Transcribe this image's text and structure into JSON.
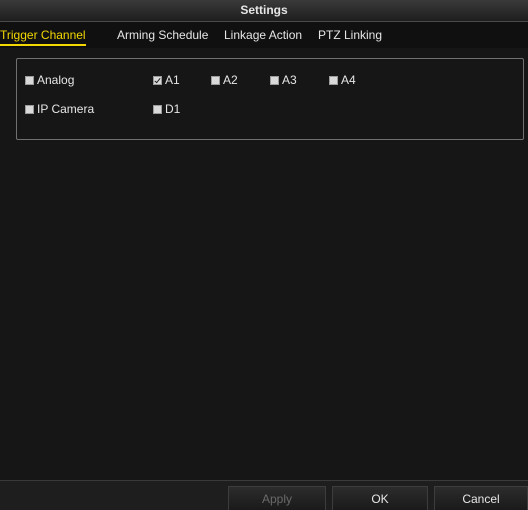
{
  "window": {
    "title": "Settings"
  },
  "tabs": [
    {
      "label": "Trigger Channel",
      "active": true
    },
    {
      "label": "Arming Schedule",
      "active": false
    },
    {
      "label": "Linkage Action",
      "active": false
    },
    {
      "label": "PTZ Linking",
      "active": false
    }
  ],
  "channels": {
    "analog": {
      "label": "Analog",
      "checked": false
    },
    "a1": {
      "label": "A1",
      "checked": true
    },
    "a2": {
      "label": "A2",
      "checked": false
    },
    "a3": {
      "label": "A3",
      "checked": false
    },
    "a4": {
      "label": "A4",
      "checked": false
    },
    "ip_camera": {
      "label": "IP Camera",
      "checked": false
    },
    "d1": {
      "label": "D1",
      "checked": false
    }
  },
  "footer": {
    "apply_label": "Apply",
    "ok_label": "OK",
    "cancel_label": "Cancel"
  },
  "colors": {
    "active_tab": "#f2d800",
    "background": "#161616"
  }
}
